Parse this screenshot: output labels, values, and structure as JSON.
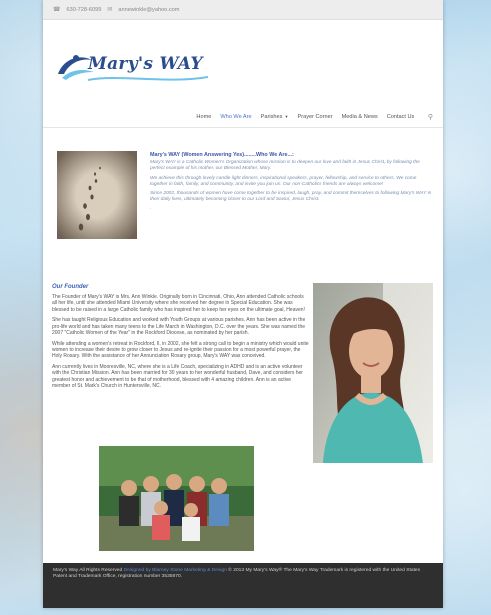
{
  "topbar": {
    "phone": "630-728-6099",
    "email": "annewinkle@yahoo.com"
  },
  "logo": {
    "text": "Mary's WAY"
  },
  "nav": {
    "items": [
      {
        "label": "Home"
      },
      {
        "label": "Who We Are",
        "active": true
      },
      {
        "label": "Parishes"
      },
      {
        "label": "Prayer Corner"
      },
      {
        "label": "Media & News"
      },
      {
        "label": "Contact Us"
      }
    ]
  },
  "intro": {
    "title": "Mary's WAY (Women Answering Yes)........Who We Are...:",
    "p1": "Mary's WAY is a Catholic Women's Organization whose mission is to deepen our love and faith in Jesus Christ, by following the perfect example of his mother, our Blessed Mother, Mary.",
    "p2": "We achieve this through lovely candle light dinners, inspirational speakers, prayer, fellowship, and service to others. We come together in faith, family, and community, and invite you join us.  Our non-Catholics friends are always welcome!",
    "p3": "Since 2002, thousands of women have come together to be inspired, laugh, pray, and commit themselves to following Mary's WAY in their daily lives, ultimately becoming closer to our Lord and Savior, Jesus Christ.",
    "p4": "."
  },
  "founder": {
    "title": "Our Founder",
    "p1": "The Founder of Mary's WAY is Mrs. Ann Winkle. Originally born in Cincinnati, Ohio, Ann attended Catholic schools all her life, until she attended Miami University where she received her degree in Special Education. She was blessed to be raised in a large Catholic family who has inspired her to keep her eyes on the ultimate goal, Heaven!",
    "p2": "She has taught Religious Education and worked with Youth Groups at various parishes. Ann has been active in the pro-life world and has taken many teens to the Life March in Washington, D.C. over the years.  She was named the 2007 \"Catholic Women of the Year\" in the Rockford Diocese, as nominated by her parish.",
    "p3": "While attending a women's retreat in Rockford, Il, in 2002, she felt a strong call to begin a ministry which would unite women to increase their desire to grow closer to Jesus and re-ignite their passion for a  most powerful prayer, the Holy Rosary. With the assistance of her Annunciation Rosary group, Mary's WAY was conceived.",
    "p4": "Ann currently lives in Mooresville, NC, where she is a Life Coach, specializing in ADHD and is an active volunteer with the Christian Mission.  Ann has been married for 30 years to her wonderful husband, Dave, and considers her greatest honor and achievement to be that of motherhood, blessed with 4 amazing children. Ann is an active member of St. Mark's Church in Huntersville, NC."
  },
  "footer": {
    "line1_prefix": "Mary's Way All Rights Reserved ",
    "line1_link": "Designed by Blarney Stone Marketing & Design",
    "line1_suffix": " © 2013 My Mary's Way® The Mary's Way Trademark is registered with the United States Patent and Trademark Office, registration number 3535870."
  }
}
